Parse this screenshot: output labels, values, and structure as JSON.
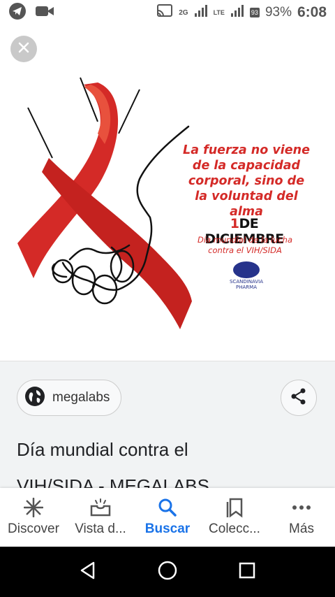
{
  "status_bar": {
    "network_2g": "2G",
    "network_lte": "LTE",
    "sim_badge": "93",
    "battery_pct": "93%",
    "time": "6:08",
    "icons": [
      "telegram-icon",
      "video-camera-icon",
      "cast-icon",
      "signal-icon",
      "battery-icon"
    ]
  },
  "image": {
    "quote": "La fuerza no viene de la capacidad corporal, sino de la voluntad del alma",
    "date_num": "1",
    "date_text": "DE DICIEMBRE",
    "subtitle": "Día mundial de la lucha contra el VIH/SIDA",
    "brand": "SCANDINAVIA PHARMA",
    "ribbon_color": "#d42a27"
  },
  "result": {
    "source": "megalabs",
    "title_line1": "Día mundial contra el",
    "title_line2": "VIH/SIDA - MEGALABS"
  },
  "bottom_nav": {
    "items": [
      {
        "label": "Discover",
        "icon": "asterisk-icon"
      },
      {
        "label": "Vista d...",
        "icon": "inbox-icon"
      },
      {
        "label": "Buscar",
        "icon": "search-icon"
      },
      {
        "label": "Colecc...",
        "icon": "bookmarks-icon"
      },
      {
        "label": "Más",
        "icon": "more-dots-icon"
      }
    ]
  }
}
